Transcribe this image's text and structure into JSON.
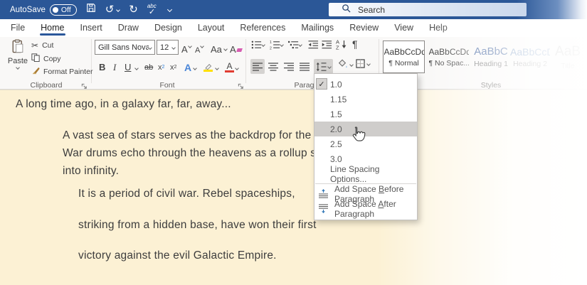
{
  "colors": {
    "accent": "#2b579a",
    "titlebar": "#2b5797",
    "doc_bg": "#fcf1d4",
    "heading_blue": "#2f5496",
    "highlight_yellow": "#ffe000",
    "font_color_red": "#e03c31"
  },
  "titlebar": {
    "autosave_label": "AutoSave",
    "autosave_state": "Off",
    "search_placeholder": "Search"
  },
  "tabs": {
    "items": [
      "File",
      "Home",
      "Insert",
      "Draw",
      "Design",
      "Layout",
      "References",
      "Mailings",
      "Review",
      "View",
      "Help"
    ],
    "active": "Home"
  },
  "ribbon": {
    "clipboard": {
      "label": "Clipboard",
      "paste": "Paste",
      "cut": "Cut",
      "copy": "Copy",
      "format_painter": "Format Painter"
    },
    "font": {
      "label": "Font",
      "font_name": "Gill Sans Nova Li",
      "font_size": "12",
      "grow": "A",
      "shrink": "A",
      "change_case": "Aa",
      "clear": "A",
      "bold": "B",
      "italic": "I",
      "underline": "U",
      "strike": "ab",
      "sub_base": "x",
      "sub_n": "2",
      "sup_base": "x",
      "sup_n": "2",
      "effects": "A",
      "font_color": "A"
    },
    "paragraph": {
      "label": "Paragraph",
      "pilcrow": "¶"
    },
    "styles": {
      "label": "Styles",
      "items": [
        {
          "preview": "AaBbCcDd",
          "name": "¶ Normal"
        },
        {
          "preview": "AaBbCcDd",
          "name": "¶ No Spac..."
        },
        {
          "preview": "AaBbC",
          "name": "Heading 1"
        },
        {
          "preview": "AaBbCcD",
          "name": "Heading 2"
        },
        {
          "preview": "AaB",
          "name": "Title"
        }
      ]
    }
  },
  "spacing_menu": {
    "items": [
      "1.0",
      "1.15",
      "1.5",
      "2.0",
      "2.5",
      "3.0"
    ],
    "checked_item": "1.0",
    "hover_item": "2.0",
    "options_label": "Line Spacing Options...",
    "add_before_pre": "Add Space ",
    "add_before_key": "B",
    "add_before_post": "efore Paragraph",
    "add_after_pre": "Add Space ",
    "add_after_key": "A",
    "add_after_post": "fter Paragraph"
  },
  "document": {
    "line1": "A long time ago, in a galaxy far, far, away...",
    "line2": "A vast sea of stars serves as the backdrop for the main ti",
    "line3": "War drums echo through the heavens as a rollup slowly",
    "line4": "into infinity.",
    "line5": "It is a period of civil war. Rebel spaceships,",
    "line6": "striking from a hidden base, have won their first",
    "line7": "victory against the evil Galactic Empire."
  }
}
